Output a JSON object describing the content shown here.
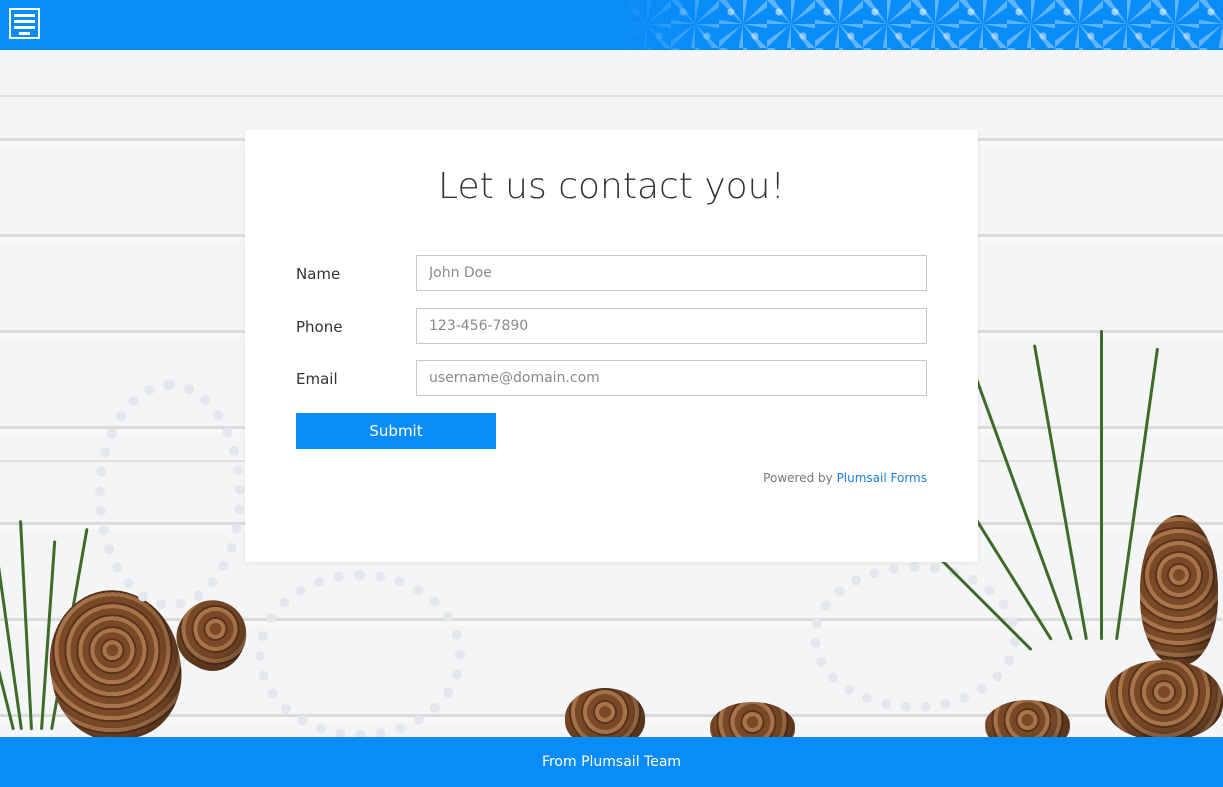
{
  "header": {
    "app_icon": "form-icon"
  },
  "form": {
    "title": "Let us contact you!",
    "fields": [
      {
        "label": "Name",
        "placeholder": "John Doe",
        "value": ""
      },
      {
        "label": "Phone",
        "placeholder": "123-456-7890",
        "value": ""
      },
      {
        "label": "Email",
        "placeholder": "username@domain.com",
        "value": ""
      }
    ],
    "submit_label": "Submit",
    "powered_prefix": "Powered by",
    "powered_link": "Plumsail Forms"
  },
  "footer": {
    "text": "From Plumsail Team"
  },
  "colors": {
    "accent": "#0a8cf8",
    "link": "#1a7ee0"
  }
}
